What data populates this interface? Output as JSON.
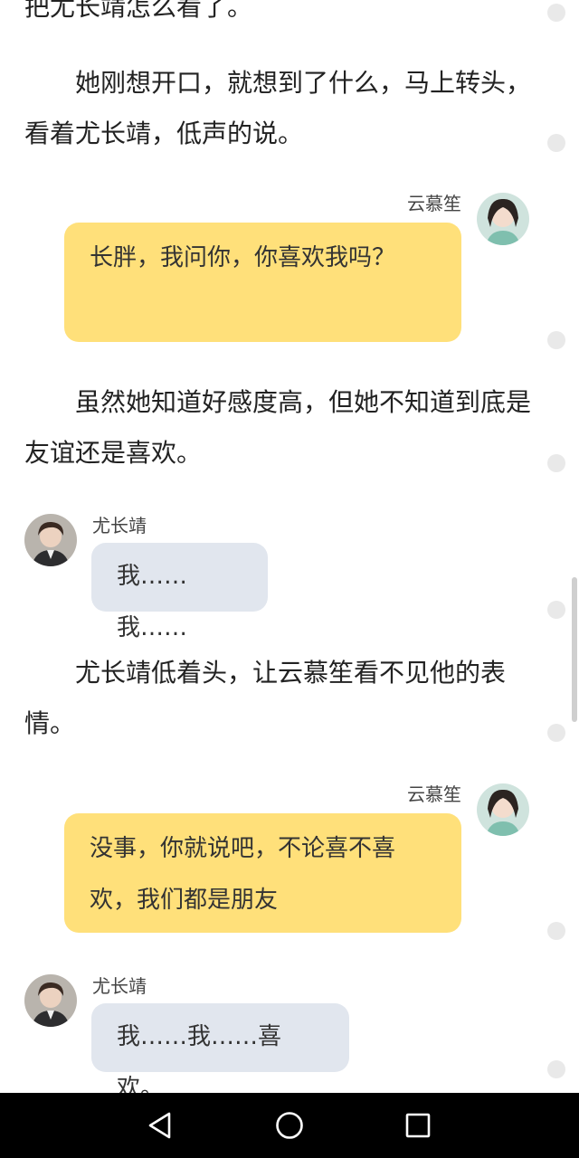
{
  "story": {
    "p0": "把尤长靖怎么看了。",
    "p1": "她刚想开口，就想到了什么，马上转头，看着尤长靖，低声的说。",
    "p2": "虽然她知道好感度高，但她不知道到底是友谊还是喜欢。",
    "p3": "尤长靖低着头，让云慕笙看不见他的表情。"
  },
  "messages": [
    {
      "speaker": "云慕笙",
      "text": "长胖，我问你，你喜欢我吗？",
      "side": "right"
    },
    {
      "speaker": "尤长靖",
      "text": "我……我……",
      "side": "left"
    },
    {
      "speaker": "云慕笙",
      "text": "没事，你就说吧，不论喜不喜欢，我们都是朋友",
      "side": "right"
    },
    {
      "speaker": "尤长靖",
      "text": "我……我……喜欢。",
      "side": "left"
    }
  ],
  "icons": {
    "nav_back": "triangle-back-icon",
    "nav_home": "circle-home-icon",
    "nav_recents": "square-recents-icon"
  },
  "colors": {
    "yellow_bubble": "#ffe07a",
    "gray_bubble": "#e1e6ee",
    "navbar": "#000000"
  }
}
